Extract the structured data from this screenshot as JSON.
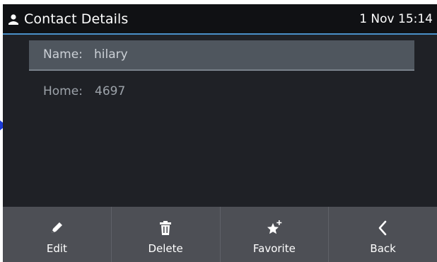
{
  "header": {
    "title": "Contact Details",
    "clock": "1 Nov 15:14",
    "icon": "person-icon"
  },
  "fields": [
    {
      "label": "Name:",
      "value": "hilary",
      "selected": true
    },
    {
      "label": "Home:",
      "value": "4697",
      "selected": false
    }
  ],
  "softkeys": [
    {
      "label": "Edit",
      "icon": "pencil-icon"
    },
    {
      "label": "Delete",
      "icon": "trash-icon"
    },
    {
      "label": "Favorite",
      "icon": "star-plus-icon"
    },
    {
      "label": "Back",
      "icon": "chevron-left-icon"
    }
  ],
  "colors": {
    "title_bg": "#101114",
    "accent": "#4a90c8",
    "screen_bg": "#1f2126",
    "softkey_bg": "#4d4f55",
    "selected_row": "#4f565e",
    "pointer_arrow": "#1a3ad6"
  }
}
